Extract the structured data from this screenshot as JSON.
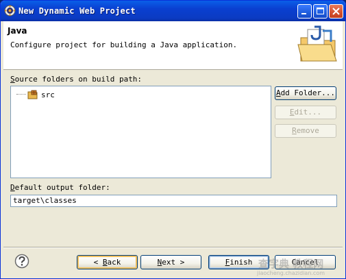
{
  "window": {
    "title": "New Dynamic Web Project",
    "controls": [
      "minimize-icon",
      "maximize-icon",
      "close-icon"
    ]
  },
  "header": {
    "title": "Java",
    "description": "Configure project for building a Java application."
  },
  "source": {
    "label_mnemonic": "S",
    "label_rest": "ource folders on build path:",
    "items": [
      {
        "label": "src",
        "icon": "package-folder-icon"
      }
    ]
  },
  "buttons": {
    "add_folder_mnemonic": "A",
    "add_folder_rest": "dd Folder...",
    "edit_mnemonic": "E",
    "edit_rest": "dit...",
    "remove_mnemonic": "R",
    "remove_rest": "emove"
  },
  "output": {
    "label_mnemonic": "D",
    "label_rest": "efault output folder:",
    "value": "target\\classes"
  },
  "footer": {
    "back_prefix": "< ",
    "back_mnemonic": "B",
    "back_rest": "ack",
    "next_mnemonic": "N",
    "next_rest": "ext >",
    "finish_mnemonic": "F",
    "finish_rest": "inish",
    "cancel": "Cancel"
  },
  "watermark": {
    "main": "查字典 教程网",
    "url": "jiaocheng.chazidian.com"
  },
  "colors": {
    "titlebar": "#0a3fd0",
    "dialog_bg": "#ece9d8",
    "button_border": "#003c74",
    "field_border": "#7f9db9"
  }
}
